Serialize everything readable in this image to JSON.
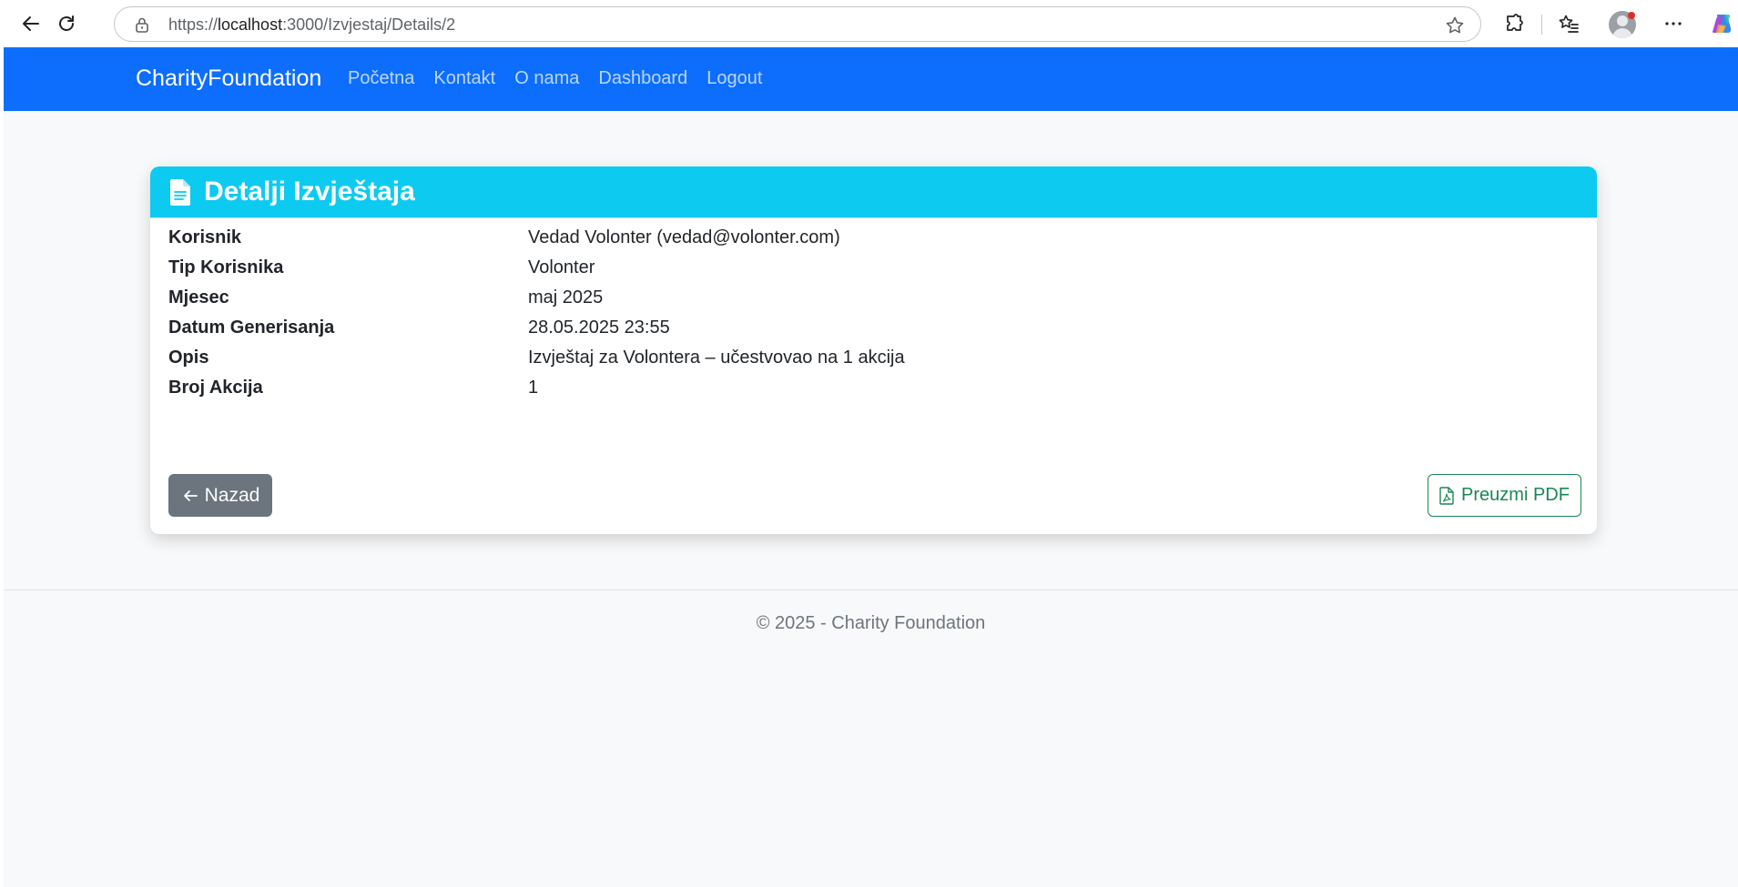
{
  "browser": {
    "url_prefix": "https://",
    "url_host": "localhost",
    "url_rest": ":3000/Izvjestaj/Details/2"
  },
  "navbar": {
    "brand": "CharityFoundation",
    "links": [
      "Početna",
      "Kontakt",
      "O nama",
      "Dashboard",
      "Logout"
    ]
  },
  "card": {
    "title": "Detalji Izvještaja",
    "rows": [
      {
        "label": "Korisnik",
        "value": "Vedad Volonter (vedad@volonter.com)"
      },
      {
        "label": "Tip Korisnika",
        "value": "Volonter"
      },
      {
        "label": "Mjesec",
        "value": "maj 2025"
      },
      {
        "label": "Datum Generisanja",
        "value": "28.05.2025 23:55"
      },
      {
        "label": "Opis",
        "value": "Izvještaj za Volontera – učestvovao na 1 akcija"
      },
      {
        "label": "Broj Akcija",
        "value": "1"
      }
    ],
    "back_label": "Nazad",
    "pdf_label": "Preuzmi PDF"
  },
  "footer": {
    "text": "© 2025 - Charity Foundation"
  },
  "colors": {
    "navbar": "#0d6efd",
    "card_header": "#0dcaf0",
    "back_button": "#6c757d",
    "pdf_button": "#198754",
    "page_background": "#f8f9fa"
  }
}
